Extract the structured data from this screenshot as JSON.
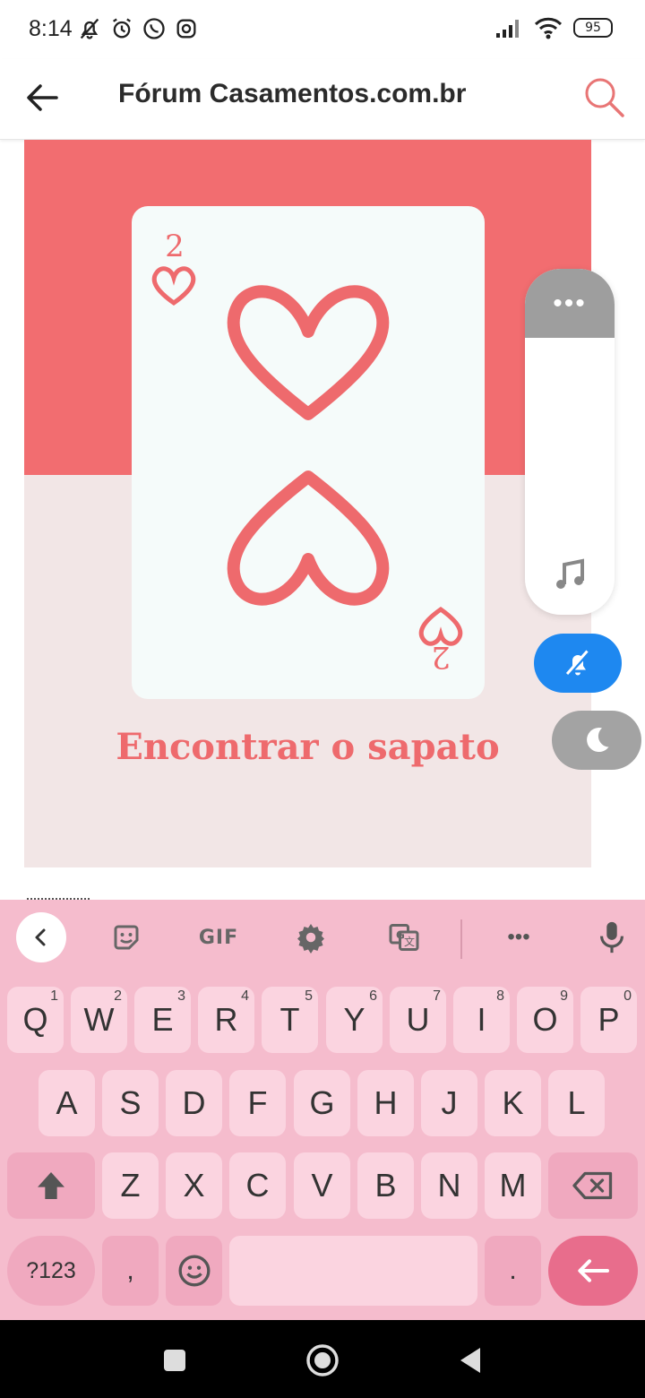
{
  "status_bar": {
    "time": "8:14",
    "battery": "95",
    "left_icons": [
      "bell-off-icon",
      "alarm-icon",
      "whatsapp-icon",
      "instagram-icon"
    ],
    "right_icons": [
      "signal-icon",
      "wifi-icon",
      "battery-icon"
    ]
  },
  "app_bar": {
    "title": "Fórum Casamentos.com.br",
    "back_icon": "back-arrow-icon",
    "search_icon": "search-icon"
  },
  "post": {
    "card_rank": "2",
    "caption": "Encontrar o sapato",
    "colors": {
      "band": "#f26d70",
      "background": "#f2e6e6",
      "card": "#f5fbfa",
      "accent": "#ee6a6d"
    }
  },
  "side_panel": {
    "grip": "•••",
    "icons": [
      "music-note-icon",
      "bell-off-icon",
      "moon-icon"
    ]
  },
  "keyboard": {
    "toolbar": {
      "back_icon": "chevron-left-icon",
      "sticker_icon": "sticker-icon",
      "gif_label": "GIF",
      "settings_icon": "gear-icon",
      "translate_icon": "translate-icon",
      "more_label": "•••",
      "mic_icon": "microphone-icon"
    },
    "row1": [
      {
        "key": "Q",
        "hint": "1"
      },
      {
        "key": "W",
        "hint": "2"
      },
      {
        "key": "E",
        "hint": "3"
      },
      {
        "key": "R",
        "hint": "4"
      },
      {
        "key": "T",
        "hint": "5"
      },
      {
        "key": "Y",
        "hint": "6"
      },
      {
        "key": "U",
        "hint": "7"
      },
      {
        "key": "I",
        "hint": "8"
      },
      {
        "key": "O",
        "hint": "9"
      },
      {
        "key": "P",
        "hint": "0"
      }
    ],
    "row2": [
      "A",
      "S",
      "D",
      "F",
      "G",
      "H",
      "J",
      "K",
      "L"
    ],
    "row3": [
      "Z",
      "X",
      "C",
      "V",
      "B",
      "N",
      "M"
    ],
    "row4": {
      "symbols_label": "?123",
      "comma": ",",
      "period": "."
    },
    "colors": {
      "background": "#f5bccd",
      "key": "#fbd4e0",
      "special": "#f0a9bf",
      "enter": "#e86d8c"
    }
  },
  "nav_bar": {
    "icons": [
      "recents-icon",
      "home-icon",
      "back-icon"
    ]
  }
}
